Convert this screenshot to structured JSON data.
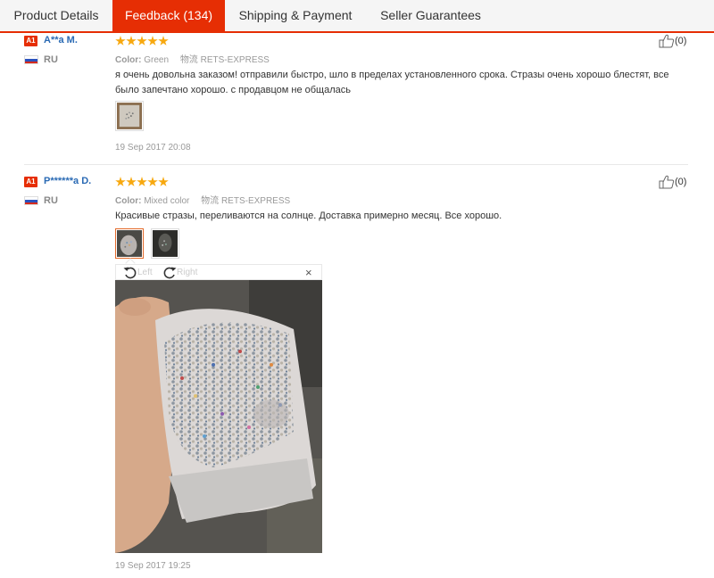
{
  "tabs": [
    {
      "label": "Product Details"
    },
    {
      "label": "Feedback (134)"
    },
    {
      "label": "Shipping & Payment"
    },
    {
      "label": "Seller Guarantees"
    }
  ],
  "reviews": [
    {
      "badge": "A1",
      "name": "A**a M.",
      "country": "RU",
      "rating": 5,
      "color_label": "Color:",
      "color_value": "Green",
      "logistics_label": "物流",
      "logistics_value": "RETS-EXPRESS",
      "text": "я очень довольна заказом! отправили быстро, шло в пределах установленного срока. Стразы очень хорошо блестят, все было запечтано хорошо. с продавцом не общалась",
      "date": "19 Sep 2017 20:08",
      "likes": "(0)"
    },
    {
      "badge": "A1",
      "name": "P******a D.",
      "country": "RU",
      "rating": 5,
      "color_label": "Color:",
      "color_value": "Mixed color",
      "logistics_label": "物流",
      "logistics_value": "RETS-EXPRESS",
      "text": "Красивые стразы, переливаются на солнце. Доставка примерно месяц. Все хорошо.",
      "date": "19 Sep 2017 19:25",
      "likes": "(0)"
    }
  ],
  "viewer": {
    "rotate_left_label": "Left",
    "rotate_right_label": "Right",
    "close_label": "×"
  },
  "colors": {
    "accent": "#e62e04",
    "star": "#f7a80f",
    "link": "#2a6ab4"
  }
}
